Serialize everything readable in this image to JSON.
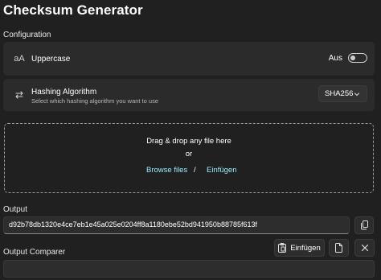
{
  "app": {
    "title": "Checksum Generator"
  },
  "configuration": {
    "label": "Configuration",
    "uppercase": {
      "icon": "letter-case-icon",
      "icon_text": "aA",
      "label": "Uppercase",
      "toggle_state_text": "Aus",
      "toggle_on": false
    },
    "hashing": {
      "icon": "swap-arrows-icon",
      "label": "Hashing Algorithm",
      "description": "Select which hashing algorithm you want to use",
      "selected": "SHA256"
    }
  },
  "dropzone": {
    "line1": "Drag & drop any file here",
    "line2": "or",
    "browse_label": "Browse files",
    "separator": "/",
    "paste_label": "Einfügen"
  },
  "output": {
    "label": "Output",
    "value": "d92b78db1320e4ce7eb1e45a025e0204ff8a1180ebe52bd941950b88785f613f",
    "copy_icon": "copy-icon"
  },
  "comparer": {
    "label": "Output Comparer",
    "paste_label": "Einfügen",
    "paste_icon": "clipboard-icon",
    "file_icon": "file-icon",
    "clear_icon": "close-icon",
    "value": ""
  }
}
